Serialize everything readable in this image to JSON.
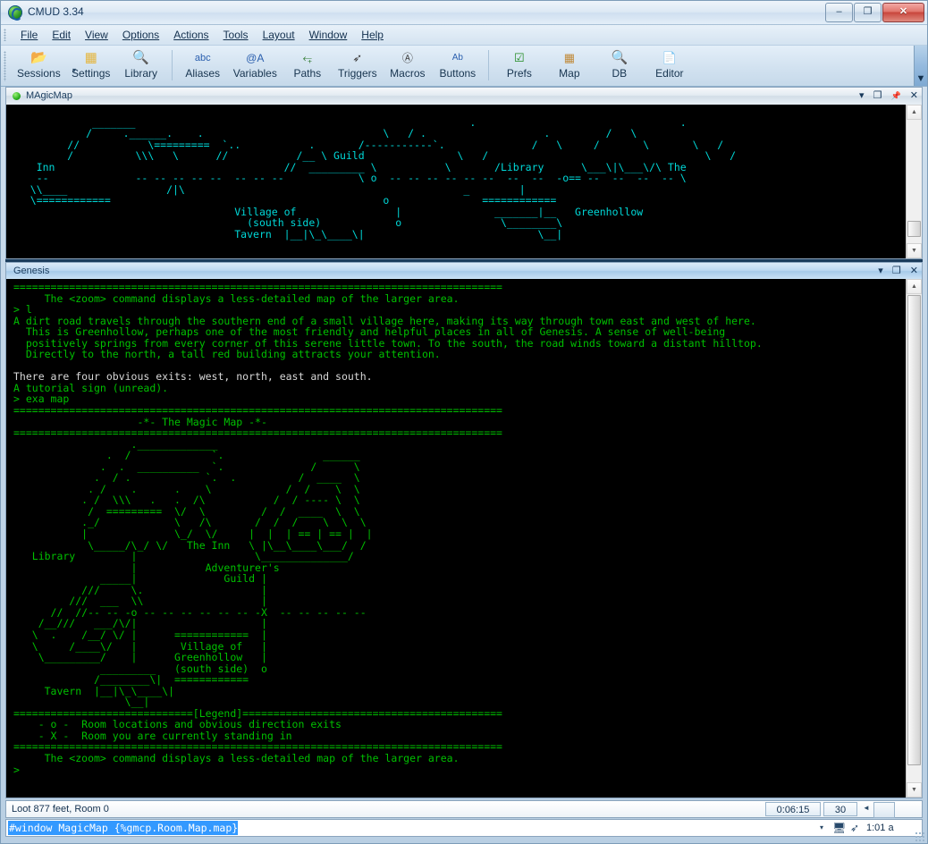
{
  "window": {
    "title": "CMUD 3.34",
    "app_icon": "cmud-logo-icon",
    "minimize": "–",
    "maximize": "❐",
    "close": "✕"
  },
  "menubar": {
    "items": [
      {
        "label": "File"
      },
      {
        "label": "Edit"
      },
      {
        "label": "View"
      },
      {
        "label": "Options"
      },
      {
        "label": "Actions"
      },
      {
        "label": "Tools"
      },
      {
        "label": "Layout"
      },
      {
        "label": "Window"
      },
      {
        "label": "Help"
      }
    ],
    "overflow_glyph": "▼"
  },
  "toolbar": {
    "items": [
      {
        "label": "Sessions",
        "icon": "folder-icon",
        "glyph": "📂",
        "color": "#e0a93a",
        "has_dropdown": true
      },
      {
        "label": "Settings",
        "icon": "settings-stack-icon",
        "glyph": "⬛",
        "color": "#e5b63f"
      },
      {
        "label": "Library",
        "icon": "library-magnifier-icon",
        "glyph": "🔍",
        "color": "#6f93b6"
      },
      {
        "separator": true
      },
      {
        "label": "Aliases",
        "icon": "abc-icon",
        "glyph": "abc",
        "color": "#2a5fae"
      },
      {
        "label": "Variables",
        "icon": "at-a-icon",
        "glyph": "@A",
        "color": "#2a5fae"
      },
      {
        "label": "Paths",
        "icon": "running-man-icon",
        "glyph": "⤵",
        "color": "#2f7a2f"
      },
      {
        "label": "Triggers",
        "icon": "gun-icon",
        "glyph": "➶",
        "color": "#3a3a3a"
      },
      {
        "label": "Macros",
        "icon": "key-a-icon",
        "glyph": "Ⓐ",
        "color": "#3a3a3a"
      },
      {
        "label": "Buttons",
        "icon": "ab-button-icon",
        "glyph": "Ab",
        "color": "#2a5fae"
      },
      {
        "separator": true
      },
      {
        "label": "Prefs",
        "icon": "checkbox-icon",
        "glyph": "✓",
        "color": "#1f8a1f"
      },
      {
        "label": "Map",
        "icon": "map-icon",
        "glyph": "▦",
        "color": "#c08a3a"
      },
      {
        "label": "DB",
        "icon": "database-magnifier-icon",
        "glyph": "🔍",
        "color": "#6f93b6"
      },
      {
        "label": "Editor",
        "icon": "document-icon",
        "glyph": "📄",
        "color": "#6f93b6"
      }
    ],
    "dropdown_glyph": "▾",
    "overflow_glyph": "▼"
  },
  "magicmap_window": {
    "title": "MAgicMap",
    "status_dot": "green",
    "buttons": [
      "▾",
      "❐",
      "📌",
      "✕"
    ],
    "text_color": "#00d8d8",
    "content": "                                   .       .        /  .             / `. .       .-./   .    .          `          ____                          /   \\                       /  ^      .   .    \\    /  ^         /             .------.           .             /   \\.  /       .   \\.    /     /`\\   /  \\       /`.  \\   .\\\\\\   /========= `./ \\_______      \\    \\ /  /  /  \\.   /   \\./   \\.\\\\\\    /  \\\\\\      /========= `. \\ / \\       \\   /  \\  /   /Inn      /   \\   `.    /    /   \\      /      Library       \\___\\|\\___\\/  The  .   `.    _________/       \\  ./        \\     .   ==        ==     \\   /       \\\\    |      |         |    \\ /         \\     /     .        |           /     Adventurer's /    \\_/\\__ /  \\   ____   |   \\.   |        /    /\\       |      /                 .     /  \\  /         \\ /\\   _/ /   /__/\\/--  --  --  --  --  o --  --  --  --  --          o --  --  --  --  --  o --  --  --  --  --     \\/ `.  \\____/\\.          |  /      `. / /   |                |    ============     /|\\    /|  /  ./| \\    Village of         |        o      _______|__                Greenhollow   \\      \\__/       (south side)                   \\________\\ |  |  \\____           ============         Tavern    |__|\\_\\____\\|                                           |            \\__|"
  },
  "genesis_window": {
    "title": "Genesis",
    "buttons": [
      "▾",
      "❐",
      "✕"
    ],
    "text_color": "#00c000",
    "lines": [
      {
        "t": "===============================================================================",
        "c": "green"
      },
      {
        "t": "     The <zoom> command displays a less-detailed map of the larger area.",
        "c": "green"
      },
      {
        "t": "> l",
        "c": "green"
      },
      {
        "t": "A dirt road travels through the southern end of a small village here, making its way through town east and west of here.",
        "c": "green"
      },
      {
        "t": "  This is Greenhollow, perhaps one of the most friendly and helpful places in all of Genesis. A sense of well-being",
        "c": "green"
      },
      {
        "t": "  positively springs from every corner of this serene little town. To the south, the road winds toward a distant hilltop.",
        "c": "green"
      },
      {
        "t": "  Directly to the north, a tall red building attracts your attention.",
        "c": "green"
      },
      {
        "t": "",
        "c": "green"
      },
      {
        "t": "There are four obvious exits: west, north, east and south.",
        "c": "white"
      },
      {
        "t": "A tutorial sign (unread).",
        "c": "green"
      },
      {
        "t": "> exa map",
        "c": "green"
      },
      {
        "t": "===============================================================================",
        "c": "green"
      },
      {
        "t": "                    -*- The Magic Map -*-",
        "c": "green"
      },
      {
        "t": "===============================================================================",
        "c": "green"
      }
    ],
    "map_art": "                   ._____________                         ______                    /              `.                     /      \\                  .    __________ `.                 /   ______ \\_               / .              `.  .        /   /       \\ \\             /    .        .    \\        /   /  _____  \\ \\           /  \\\\\\    .   .  /\\     /   /  /     \\  \\ \\         /     \\\\\\     . / \\   ./   /  /  ___  \\  \\ \\       /  =========  \\/   \\ /   /  /  /   \\  \\  \\ \\     ._/            \\    /\\  /  /  /     \\  \\  \\ \\    |              \\  /  \\/  /  /   ==  ==  \\  \\  \\/    Library      \\___\\__/\\_/  \\/   \\______\\__\\/              |  \\      /     .        |                  ____       |       ______           ./    \\      |      /      \\         /  //    \\     |     /        \\       /  //      \\    |    /   Adventurer's \\     /  //        \\   |   /      Guild     \\   /   \\\\        .  |  /                \\ /     \\\\_______  |  /                  |  --  --  --  --  --  o --  --  --  --  --  X --  --  --  --  --      \\     |     \\            |            |       \\    |      \\      ============     |        `---'       `.     Village of       |             \\      Greenhollow     |              \\    (south side)     |               \\   ============      |     _______    \\                   o     /       \\____\\                  |    Tavern  |__|\\_\\____\\|                 |            \\__|                     |",
    "legend": [
      {
        "t": "=============================[Legend]==========================================",
        "c": "green"
      },
      {
        "t": "    - o -  Room locations and obvious direction exits",
        "c": "green"
      },
      {
        "t": "    - X -  Room you are currently standing in",
        "c": "green"
      },
      {
        "t": "===============================================================================",
        "c": "green"
      },
      {
        "t": "     The <zoom> command displays a less-detailed map of the larger area.",
        "c": "green"
      },
      {
        "t": ">",
        "c": "green"
      }
    ]
  },
  "statusbar": {
    "text": "Loot 877 feet, Room 0",
    "timer": "0:06:15",
    "count": "30",
    "scroll_arrow": "◄"
  },
  "commandbar": {
    "value": "#window MagicMap {%gmcp.Room.Map.map}",
    "placeholder": "",
    "selected": true,
    "dropdown_glyph": "▾",
    "pc_icon": "computer-icon",
    "pc_glyph": "🖳",
    "gun_icon": "trigger-gun-icon",
    "gun_glyph": "➶",
    "clock": "1:01 a"
  }
}
